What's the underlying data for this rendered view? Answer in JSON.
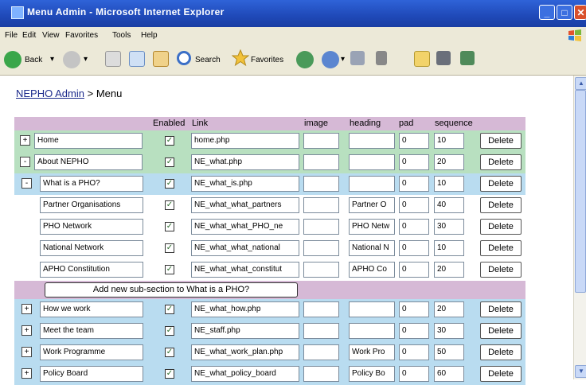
{
  "window": {
    "title": "Menu Admin - Microsoft Internet Explorer"
  },
  "menubar": {
    "items": [
      "File",
      "Edit",
      "View",
      "Favorites",
      "Tools",
      "Help"
    ]
  },
  "toolbar": {
    "back_label": "Back",
    "search_label": "Search",
    "favorites_label": "Favorites"
  },
  "breadcrumb": {
    "link": "NEPHO Admin",
    "separator": " > ",
    "current": "Menu"
  },
  "table": {
    "headers": {
      "enabled": "Enabled",
      "link": "Link",
      "image": "image",
      "heading": "heading",
      "pad": "pad",
      "sequence": "sequence"
    },
    "delete_label": "Delete",
    "rows": [
      {
        "toggle": "+",
        "name": "Home",
        "link": "home.php",
        "image": "",
        "heading": "",
        "pad": "0",
        "seq": "10",
        "enabled": true
      },
      {
        "toggle": "-",
        "name": "About NEPHO",
        "link": "NE_what.php",
        "image": "",
        "heading": "",
        "pad": "0",
        "seq": "20",
        "enabled": true
      },
      {
        "toggle": "-",
        "name": "What is a PHO?",
        "link": "NE_what_is.php",
        "image": "",
        "heading": "",
        "pad": "0",
        "seq": "10",
        "enabled": true
      },
      {
        "toggle": "",
        "name": "Partner Organisations",
        "link": "NE_what_what_partners",
        "image": "",
        "heading": "Partner O",
        "pad": "0",
        "seq": "40",
        "enabled": true
      },
      {
        "toggle": "",
        "name": "PHO Network",
        "link": "NE_what_what_PHO_ne",
        "image": "",
        "heading": "PHO Netw",
        "pad": "0",
        "seq": "30",
        "enabled": true
      },
      {
        "toggle": "",
        "name": "National Network",
        "link": "NE_what_what_national",
        "image": "",
        "heading": "National N",
        "pad": "0",
        "seq": "10",
        "enabled": true
      },
      {
        "toggle": "",
        "name": "APHO Constitution",
        "link": "NE_what_what_constitut",
        "image": "",
        "heading": "APHO Co",
        "pad": "0",
        "seq": "20",
        "enabled": true
      },
      {
        "toggle": "+",
        "name": "How we work",
        "link": "NE_what_how.php",
        "image": "",
        "heading": "",
        "pad": "0",
        "seq": "20",
        "enabled": true
      },
      {
        "toggle": "+",
        "name": "Meet the team",
        "link": "NE_staff.php",
        "image": "",
        "heading": "",
        "pad": "0",
        "seq": "30",
        "enabled": true
      },
      {
        "toggle": "+",
        "name": "Work Programme",
        "link": "NE_what_work_plan.php",
        "image": "",
        "heading": "Work Pro",
        "pad": "0",
        "seq": "50",
        "enabled": true
      },
      {
        "toggle": "+",
        "name": "Policy Board",
        "link": "NE_what_policy_board",
        "image": "",
        "heading": "Policy Bo",
        "pad": "0",
        "seq": "60",
        "enabled": true
      }
    ],
    "add_subsection_label": "Add new sub-section to What is a PHO?"
  },
  "colors": {
    "titlebar": "#2456c9",
    "green_row": "#b8e0c0",
    "blue_row": "#b9dcf0",
    "header_row": "#d6b9d6"
  }
}
